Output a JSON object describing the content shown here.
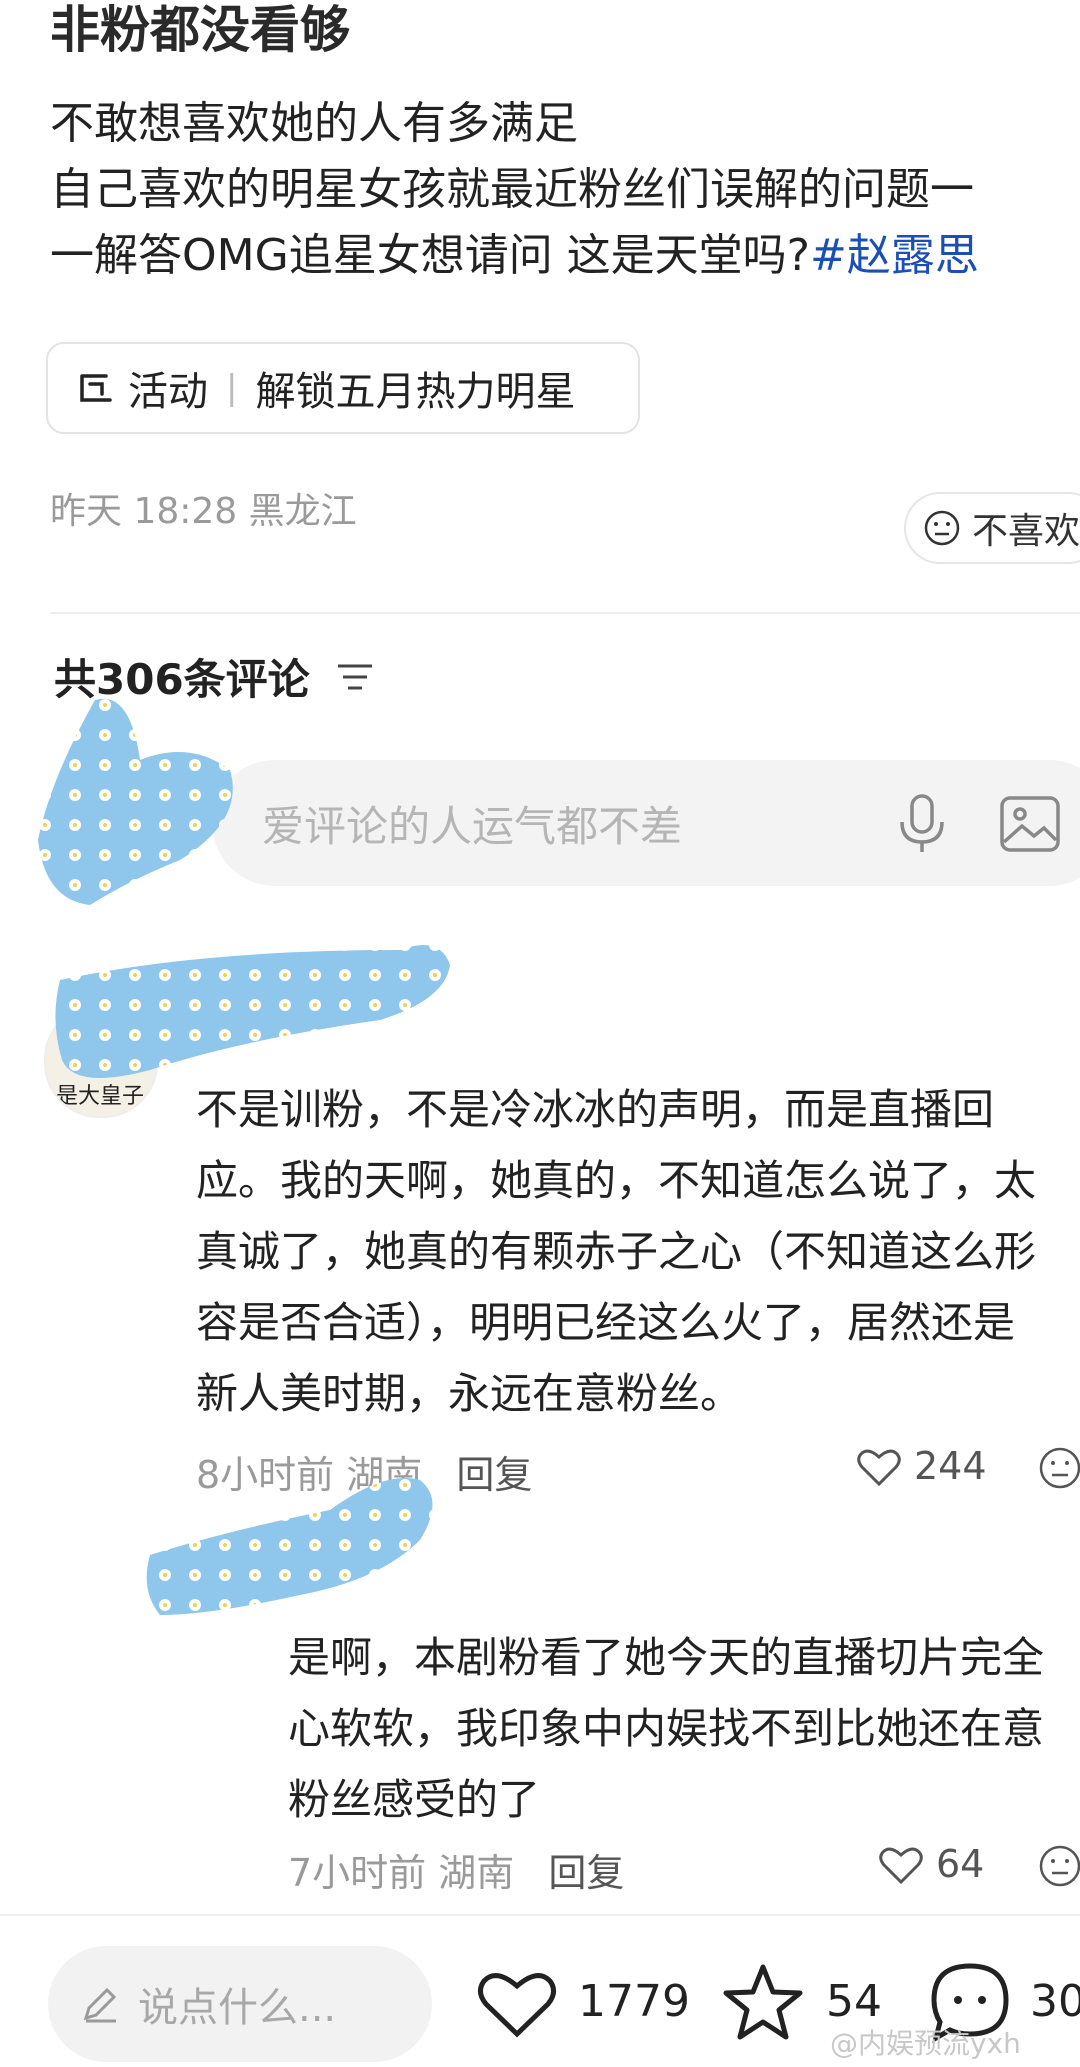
{
  "post": {
    "title": "非粉都没看够",
    "line1": "不敢想喜欢她的人有多满足",
    "line2": "自己喜欢的明星女孩就最近粉丝们误解的问题一",
    "line3_pre": "一解答OMG追星女想请问 这是天堂吗?",
    "hashtag": "#赵露思",
    "activity_label": "活动",
    "activity_text": "解锁五月热力明星",
    "meta": "昨天 18:28 黑龙江",
    "dislike_label": "不喜欢"
  },
  "comments_header": {
    "count_label": "共306条评论",
    "input_placeholder": "爱评论的人运气都不差"
  },
  "comment1": {
    "avatar_text": "是大皇子",
    "lines": [
      "不是训粉，不是冷冰冰的声明，而是直播回",
      "应。我的天啊，她真的，不知道怎么说了，太",
      "真诚了，她真的有颗赤子之心（不知道这么形",
      "容是否合适），明明已经这么火了，居然还是",
      "新人美时期，永远在意粉丝。"
    ],
    "time": "8小时前",
    "location": "湖南",
    "reply_label": "回复",
    "likes": "244"
  },
  "comment2": {
    "lines": [
      "是啊，本剧粉看了她今天的直播切片完全",
      "心软软，我印象中内娱找不到比她还在意",
      "粉丝感受的了"
    ],
    "time": "7小时前",
    "location": "湖南",
    "reply_label": "回复",
    "likes": "64"
  },
  "bottom_bar": {
    "input_placeholder": "说点什么...",
    "likes": "1779",
    "favorites": "54",
    "comments": "30"
  },
  "watermark": "@内娱预流yxh",
  "colors": {
    "hashtag": "#1b4fb3",
    "sticker": "#8ec6ec"
  }
}
